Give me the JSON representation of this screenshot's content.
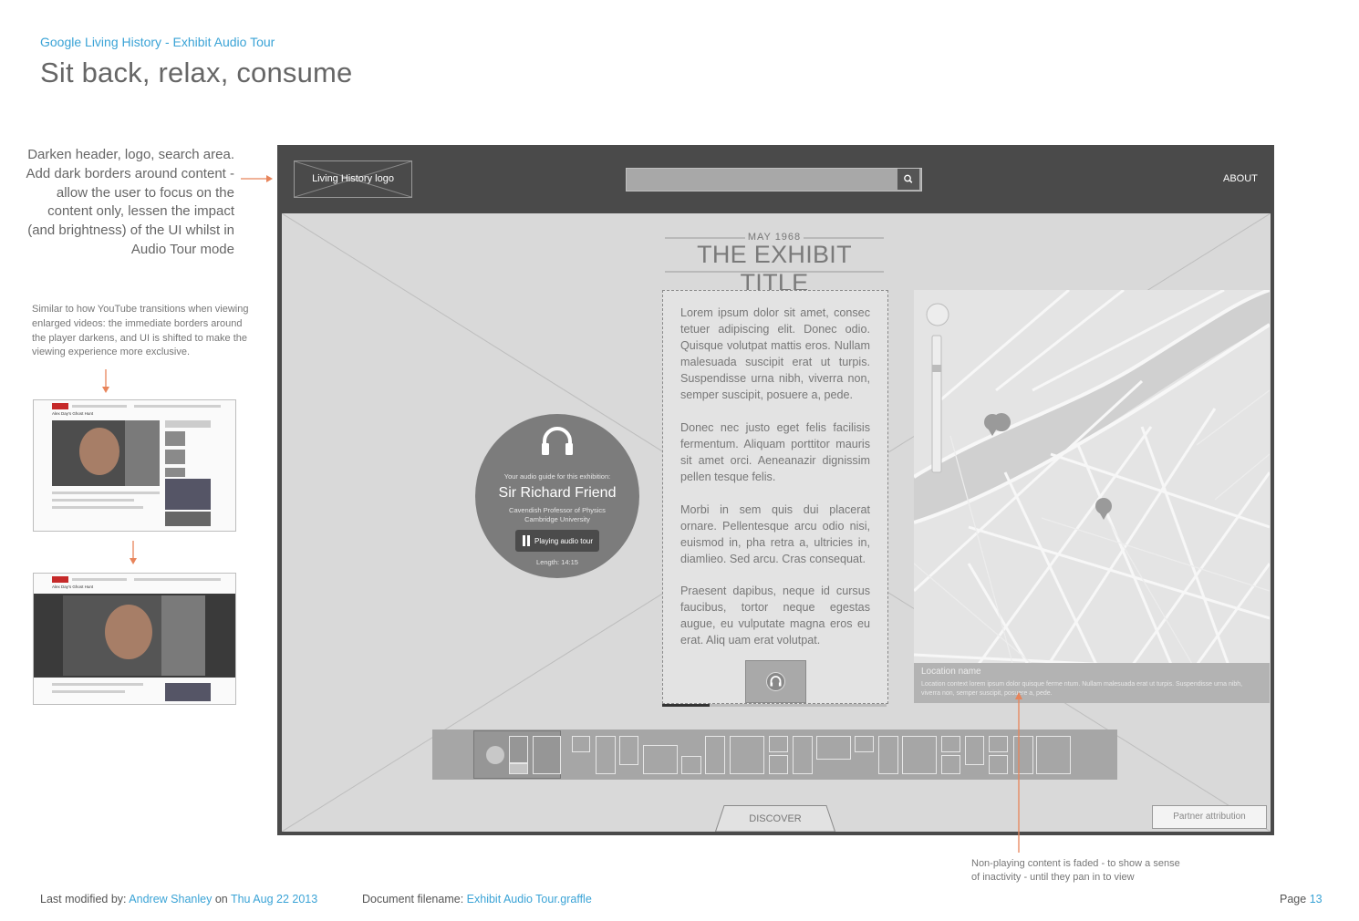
{
  "doc": {
    "subtitle": "Google Living History - Exhibit Audio Tour",
    "title": "Sit back, relax, consume"
  },
  "annotations": {
    "note_darken": "Darken header, logo, search area. Add dark borders around content - allow the user to focus on the content only, lessen the impact (and brightness) of the UI whilst in Audio Tour mode",
    "note_youtube": "Similar to how YouTube transitions when viewing enlarged videos: the immediate borders around the player darkens, and UI is shifted to make the viewing experience more exclusive.",
    "note_faded": "Non-playing content is faded - to show a sense of inactivity - until they pan in to view"
  },
  "thumbnails": {
    "video_title": "Alex Day's Ghost Hunt"
  },
  "app": {
    "logo_text": "Living History logo",
    "about_label": "ABOUT",
    "exhibit": {
      "date": "MAY 1968",
      "title": "THE EXHIBIT TITLE",
      "paragraphs": [
        "Lorem ipsum dolor sit amet, consec tetuer adipiscing elit. Donec odio. Quisque volutpat mattis eros. Nullam malesuada suscipit erat ut turpis. Suspendisse urna nibh, viverra non, semper suscipit, posuere a, pede.",
        "Donec nec justo eget felis facilisis fermentum. Aliquam porttitor mauris sit amet orci. Aeneanazir dignissim pellen tesque felis.",
        "Morbi in sem quis dui placerat ornare. Pellentesque arcu odio nisi, euismod in, pha retra a, ultricies in, diamlieo. Sed arcu. Cras consequat.",
        "Praesent dapibus, neque id cursus faucibus, tortor neque egestas augue, eu vulputate magna eros eu erat. Aliq uam erat volutpat."
      ],
      "progress_fraction": 0.21
    },
    "guide": {
      "label": "Your audio guide for this exhibition:",
      "name": "Sir Richard Friend",
      "role_line1": "Cavendish Professor of Physics",
      "role_line2": "Cambridge University",
      "button_label": "Playing audio tour",
      "length": "Length: 14:15"
    },
    "map": {
      "location_name": "Location name",
      "location_desc": "Location context lorem ipsum dolor quisque ferme ntum. Nullam malesuada erat ut turpis. Suspendisse urna nibh, viverra non, semper suscipit, posuere a, pede."
    },
    "discover_label": "DISCOVER",
    "partner_label": "Partner attribution"
  },
  "footer": {
    "modified_prefix": "Last modified by:",
    "author": "Andrew Shanley",
    "on": "on",
    "date": "Thu Aug 22 2013",
    "filename_prefix": "Document filename:",
    "filename": "Exhibit Audio Tour.graffle",
    "page_prefix": "Page",
    "page_number": "13"
  },
  "colors": {
    "accent": "#3aa3d6",
    "annotation_arrow": "#e8845a",
    "header_dark": "#4a4a4a"
  }
}
